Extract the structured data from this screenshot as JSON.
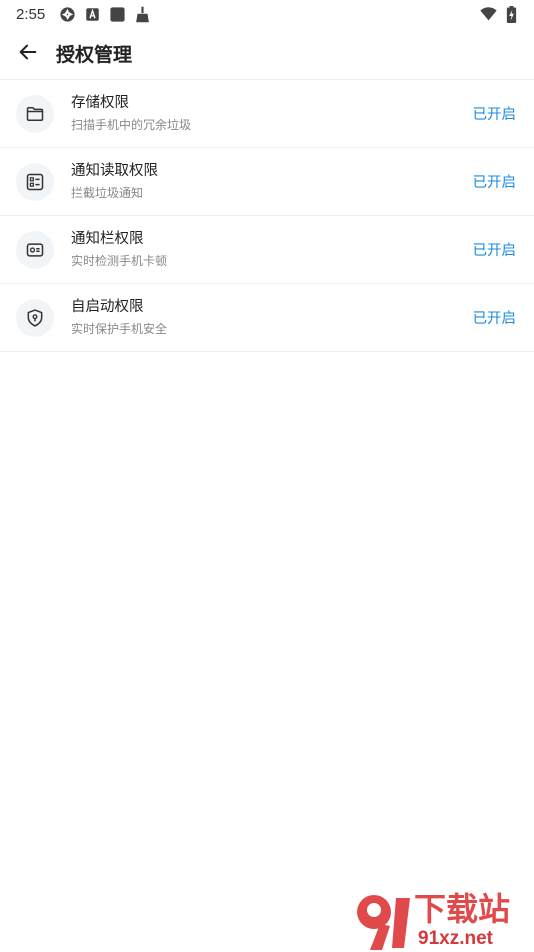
{
  "status_bar": {
    "time": "2:55",
    "icons_left": [
      "aperture-icon",
      "a-badge-icon",
      "square-app-icon",
      "broom-icon"
    ],
    "icons_right": [
      "wifi-icon",
      "battery-charging-icon"
    ]
  },
  "header": {
    "title": "授权管理"
  },
  "permissions": [
    {
      "name": "存储权限",
      "desc": "扫描手机中的冗余垃圾",
      "status": "已开启",
      "icon": "folder-icon"
    },
    {
      "name": "通知读取权限",
      "desc": "拦截垃圾通知",
      "status": "已开启",
      "icon": "list-card-icon"
    },
    {
      "name": "通知栏权限",
      "desc": "实时检测手机卡顿",
      "status": "已开启",
      "icon": "id-card-icon"
    },
    {
      "name": "自启动权限",
      "desc": "实时保护手机安全",
      "status": "已开启",
      "icon": "shield-icon"
    }
  ],
  "watermark": {
    "logo_mark": "91",
    "brand_cn": "下载站",
    "brand_en": "91xz.net"
  },
  "colors": {
    "accent": "#1c8ce0",
    "icon_bg": "#f1f5f8",
    "divider": "#eeeeee",
    "watermark_red": "#e04a4a"
  }
}
